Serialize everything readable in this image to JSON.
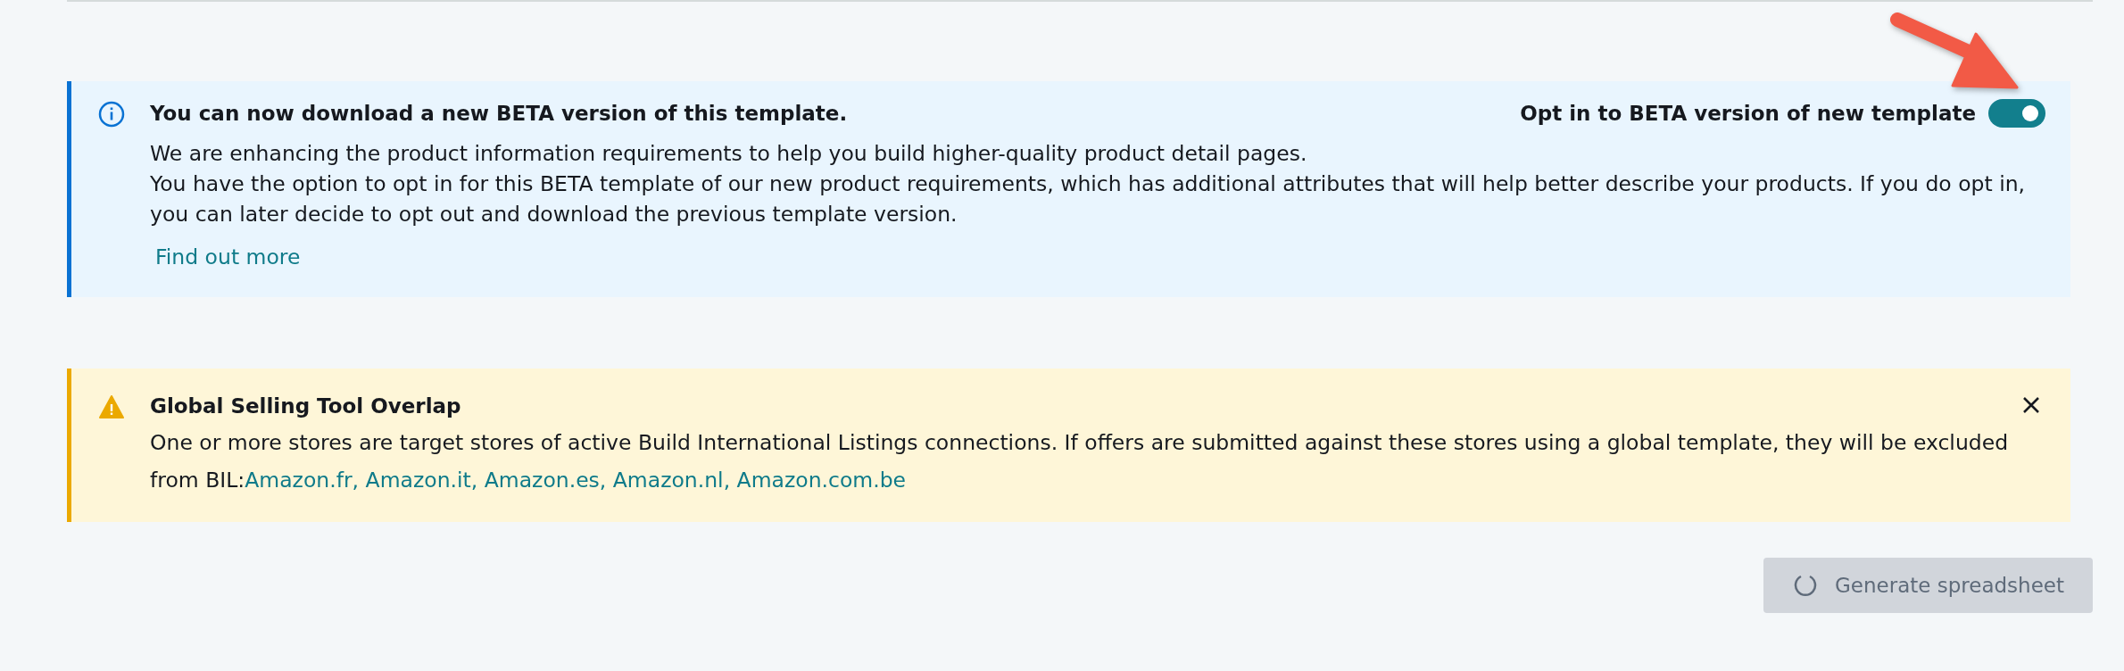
{
  "info_alert": {
    "title": "You can now download a new BETA version of this template.",
    "toggle": {
      "label": "Opt in to BETA version of new template",
      "on": true
    },
    "paragraphs": [
      "We are enhancing the product information requirements to help you build higher-quality product detail pages.",
      "You have the option to opt in for this BETA template of our new product requirements, which has additional attributes that will help better describe your products. If you do opt in, you can later decide to opt out and download the previous template version."
    ],
    "link": "Find out more"
  },
  "warning_alert": {
    "title": "Global Selling Tool Overlap",
    "text": "One or more stores are target stores of active Build International Listings connections. If offers are submitted against these stores using a global template, they will be excluded from BIL:",
    "link": "Amazon.fr, Amazon.it, Amazon.es, Amazon.nl, Amazon.com.be"
  },
  "generate_button": {
    "label": "Generate spreadsheet",
    "disabled": true,
    "loading": true
  }
}
